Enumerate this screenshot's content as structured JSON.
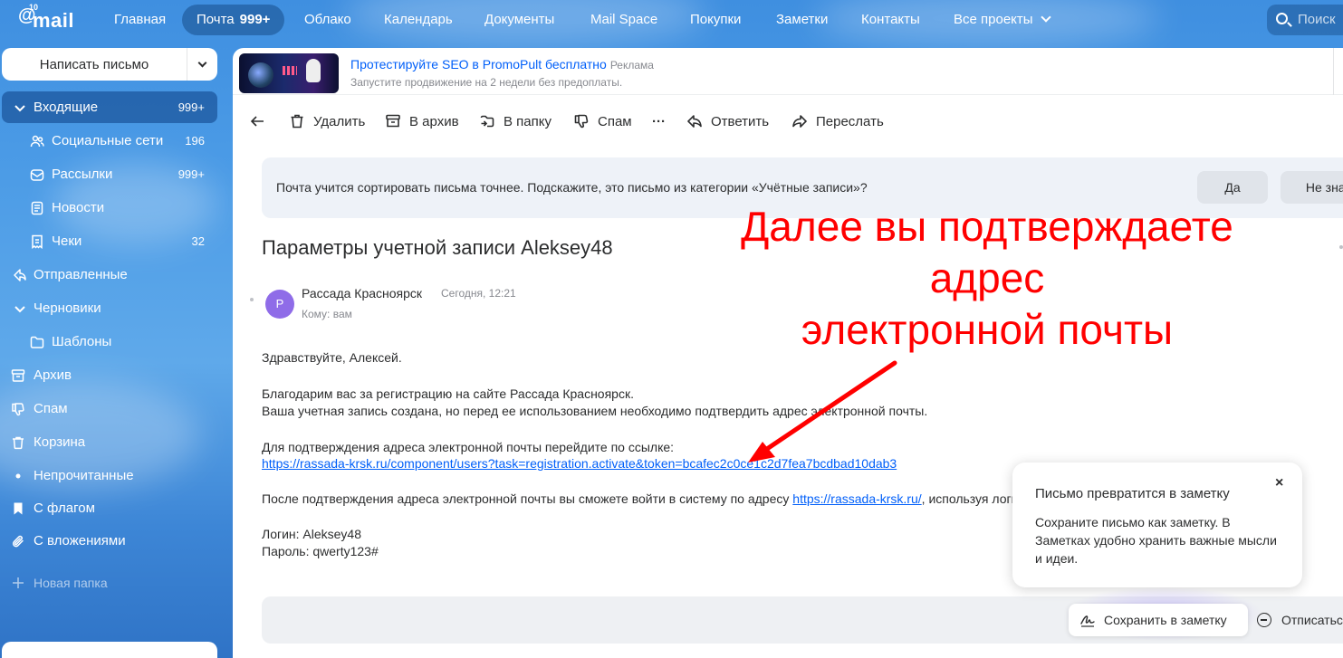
{
  "app": {
    "logo_text": "mail",
    "logo_badge": "10",
    "search_placeholder": "Поиск"
  },
  "nav": {
    "items": [
      {
        "label": "Главная"
      },
      {
        "label": "Почта",
        "count": "999+"
      },
      {
        "label": "Облако"
      },
      {
        "label": "Календарь"
      },
      {
        "label": "Документы"
      },
      {
        "label": "Mail Space"
      },
      {
        "label": "Покупки"
      },
      {
        "label": "Заметки"
      },
      {
        "label": "Контакты"
      },
      {
        "label": "Все проекты"
      }
    ]
  },
  "sidebar": {
    "compose_label": "Написать письмо",
    "folders": [
      {
        "label": "Входящие",
        "count": "999+",
        "icon": "chevron-down-icon"
      },
      {
        "label": "Социальные сети",
        "count": "196",
        "icon": "people-icon"
      },
      {
        "label": "Рассылки",
        "count": "999+",
        "icon": "newsletter-icon"
      },
      {
        "label": "Новости",
        "count": "",
        "icon": "news-icon"
      },
      {
        "label": "Чеки",
        "count": "32",
        "icon": "receipt-icon"
      },
      {
        "label": "Отправленные",
        "count": "",
        "icon": "send-icon"
      },
      {
        "label": "Черновики",
        "count": "",
        "icon": "chevron-down-icon"
      },
      {
        "label": "Шаблоны",
        "count": "",
        "icon": "folder-icon"
      },
      {
        "label": "Архив",
        "count": "",
        "icon": "archive-icon"
      },
      {
        "label": "Спам",
        "count": "",
        "icon": "thumb-down-icon"
      },
      {
        "label": "Корзина",
        "count": "",
        "icon": "trash-icon"
      },
      {
        "label": "Непрочитанные",
        "count": "",
        "icon": "dot-icon"
      },
      {
        "label": "С флагом",
        "count": "",
        "icon": "bookmark-icon"
      },
      {
        "label": "С вложениями",
        "count": "",
        "icon": "paperclip-icon"
      },
      {
        "label": "Новая папка",
        "count": "",
        "icon": "plus-icon"
      }
    ]
  },
  "ad": {
    "title": "Протестируйте SEO в PromoPult бесплатно",
    "tag": "Реклама",
    "subtitle": "Запустите продвижение на 2 недели без предоплаты."
  },
  "toolbar": {
    "delete": "Удалить",
    "archive": "В архив",
    "move": "В папку",
    "spam": "Спам",
    "more": "···",
    "reply": "Ответить",
    "forward": "Переслать"
  },
  "notice": {
    "text": "Почта учится сортировать письма точнее. Подскажите, это письмо из категории «Учётные записи»?",
    "yes": "Да",
    "no": "Не знаю"
  },
  "letter": {
    "subject": "Параметры учетной записи Aleksey48",
    "avatar_letter": "Р",
    "sender": "Рассада Красноярск",
    "time": "Сегодня, 12:21",
    "to": "Кому: вам",
    "greeting": "Здравствуйте, Алексей.",
    "thanks": "Благодарим вас за регистрацию на сайте Рассада Красноярск.",
    "created": "Ваша учетная запись создана, но перед ее использованием необходимо подтвердить адрес электронной почты.",
    "confirm_intro": "Для подтверждения адреса электронной почты перейдите по ссылке:",
    "confirm_link": "https://rassada-krsk.ru/component/users?task=registration.activate&token=bcafec2c0ce1c2d7fea7bcdbad10dab3",
    "after_prefix": "После подтверждения адреса электронной почты вы сможете войти в систему по адресу ",
    "after_link": "https://rassada-krsk.ru/",
    "after_suffix": ", используя логин и пароль, указанные ниже.",
    "login": "Логин: Aleksey48",
    "password": "Пароль: qwerty123#"
  },
  "tooltip": {
    "title": "Письмо превратится в заметку",
    "text": "Сохраните письмо как заметку. В Заметках удобно хранить важные мысли и идеи.",
    "close": "×"
  },
  "actions": {
    "save_note": "Сохранить в заметку",
    "unsubscribe": "Отписаться"
  },
  "annotation": {
    "line1": "Далее вы подтверждаете",
    "line2": "адрес",
    "line3": "электронной почты",
    "color": "#ff0000"
  },
  "colors": {
    "accent": "#005ff9",
    "avatar": "#8f6ce8"
  }
}
